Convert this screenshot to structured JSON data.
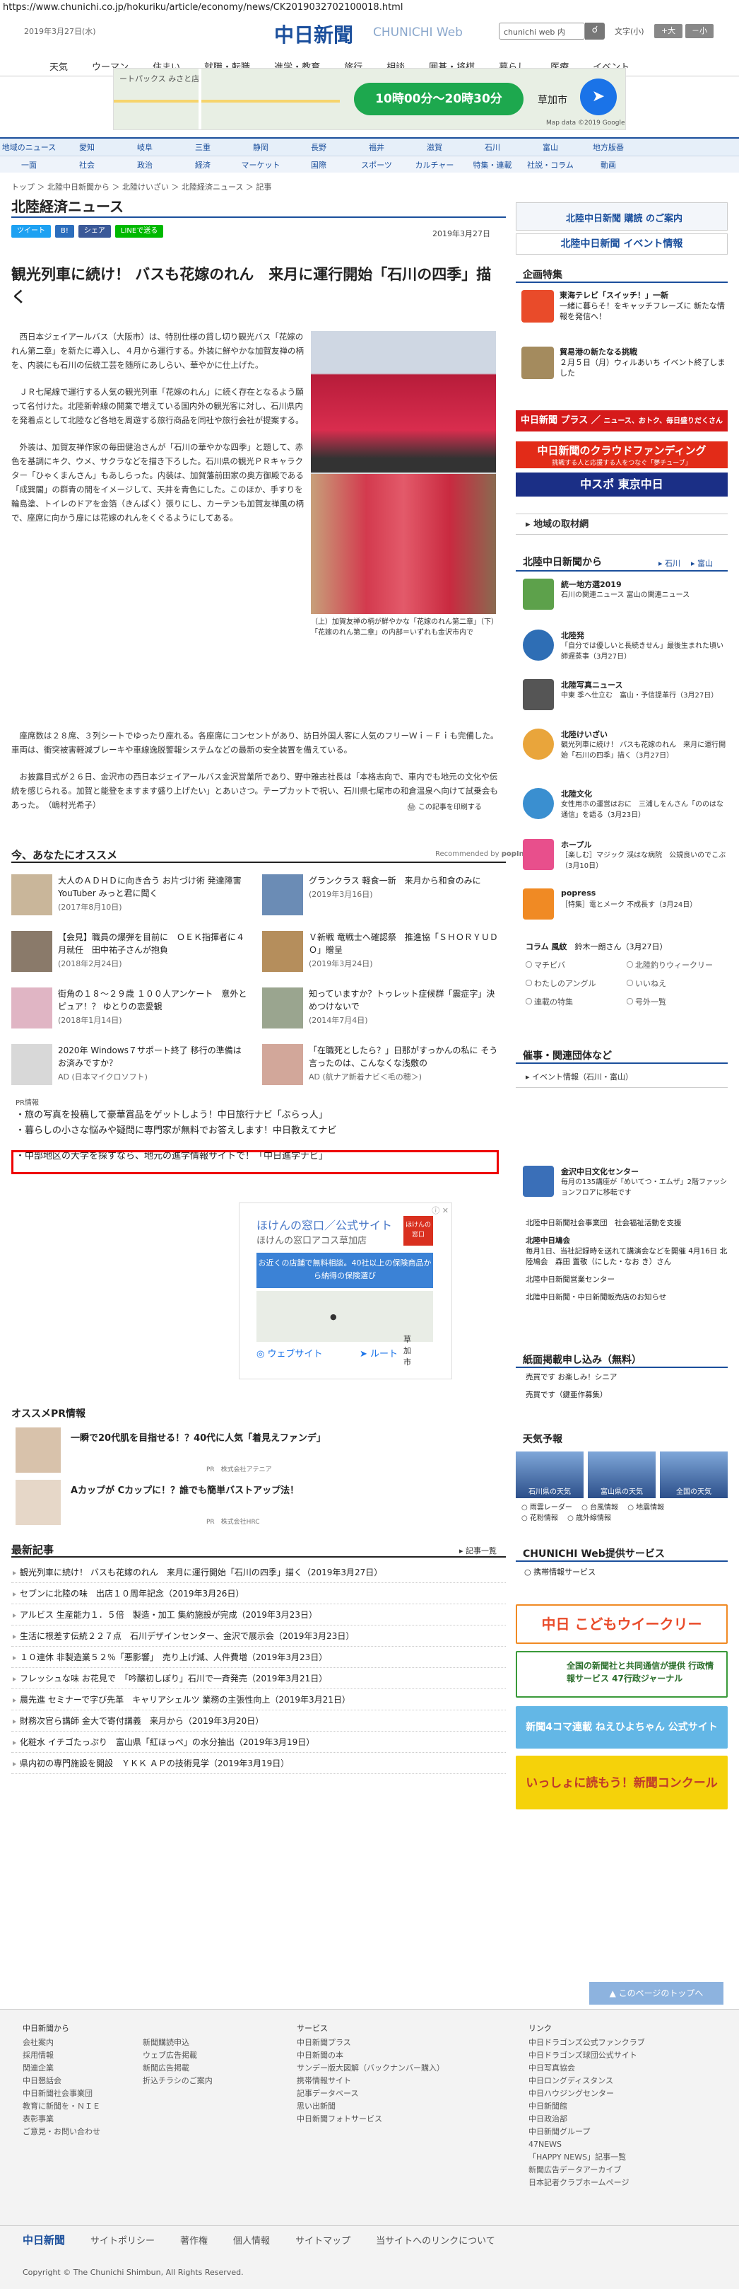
{
  "url": "https://www.chunichi.co.jp/hokuriku/article/economy/news/CK2019032702100018.html",
  "header": {
    "date": "2019年3月27日(水)",
    "logo": "中日新聞",
    "logo_sub": "CHUNICHI Web",
    "search_placeholder": "chunichi web 内",
    "font_label": "文字",
    "font_mid": "(小)",
    "font_large": "+大",
    "font_small": "－小"
  },
  "gnav": [
    "天気",
    "ウーマン",
    "住まい",
    "就職・転職",
    "進学・教育",
    "旅行",
    "相談",
    "囲碁・将棋",
    "暮らし",
    "医療",
    "イベント"
  ],
  "ad_top": {
    "hours": "10時00分～20時30分",
    "place": "草加市",
    "shop": "ートパックス みさと店",
    "mapdata": "Map data ©2019 Google"
  },
  "region_nav": {
    "row1": [
      "地域のニュース",
      "愛知",
      "岐阜",
      "三重",
      "静岡",
      "長野",
      "福井",
      "滋賀",
      "石川",
      "富山",
      "地方版番"
    ],
    "row2": [
      "一面",
      "社会",
      "政治",
      "経済",
      "マーケット",
      "国際",
      "スポーツ",
      "カルチャー",
      "特集・連載",
      "社説・コラム",
      "動画"
    ]
  },
  "breadcrumb": "トップ ＞ 北陸中日新聞から ＞ 北陸けいざい ＞ 北陸経済ニュース ＞ 記事",
  "page_title": "北陸経済ニュース",
  "share": {
    "tweet": "ツイート",
    "hatena": "B!",
    "facebook": "シェア",
    "line": "LINEで送る"
  },
  "article": {
    "date": "2019年3月27日",
    "headline": "観光列車に続け！ バスも花嫁のれん　来月に運行開始「石川の四季」描く",
    "paragraphs": [
      "西日本ジェイアールバス（大阪市）は、特別仕様の貸し切り観光バス「花嫁のれん第二章」を新たに導入し、４月から運行する。外装に鮮やかな加賀友禅の柄を、内装にも石川の伝統工芸を随所にあしらい、華やかに仕上げた。",
      "ＪＲ七尾線で運行する人気の観光列車「花嫁のれん」に続く存在となるよう願って名付けた。北陸新幹線の開業で増えている国内外の観光客に対し、石川県内を発着点として北陸など各地を周遊する旅行商品を同社や旅行会社が提案する。",
      "外装は、加賀友禅作家の毎田健治さんが「石川の華やかな四季」と題して、赤色を基調にキク、ウメ、サクラなどを描き下ろした。石川県の観光ＰＲキャラクター「ひゃくまんさん」もあしらった。内装は、加賀藩前田家の奥方御殿である「成巽閣」の群青の間をイメージして、天井を青色にした。このほか、手すりを輪島塗、トイレのドアを金箔（きんぱく）張りにし、カーテンも加賀友禅風の柄で、座席に向かう扉には花嫁のれんをくぐるようにしてある。",
      "座席数は２８席、３列シートでゆったり座れる。各座席にコンセントがあり、訪日外国人客に人気のフリーＷｉ－Ｆｉも完備した。車両は、衝突被害軽減ブレーキや車線逸脱警報システムなどの最新の安全装置を備えている。",
      "お披露目式が２６日、金沢市の西日本ジェイアールバス金沢営業所であり、野中雅志社長は「本格志向で、車内でも地元の文化や伝統を感じられる。加賀と能登をますます盛り上げたい」とあいさつ。テープカットで祝い、石川県七尾市の和倉温泉へ向けて試乗会もあった。　（嶋村光希子）"
    ],
    "caption": "（上）加賀友禅の柄が鮮やかな「花嫁のれん第二章」（下）「花嫁のれん第二章」の内部＝いずれも金沢市内で",
    "print": "この記事を印刷する"
  },
  "recommend": {
    "heading": "今、あなたにオススメ",
    "by": "Recommended by",
    "by_brand": "popIn",
    "items": [
      {
        "title": "大人のＡＤＨＤに向き合う お片づけ術 発達障害YouTuber みっと君に聞く",
        "date": "(2017年8月10日)"
      },
      {
        "title": "グランクラス 軽食一新　来月から和食のみに",
        "date": "(2019年3月16日)"
      },
      {
        "title": "【会見】職員の爆弾を目前に　ＯＥＫ指揮者に４月就任　田中祐子さんが抱負",
        "date": "(2018年2月24日)"
      },
      {
        "title": "Ｖ新戦 竜戦士へ確認祭　推進協「ＳＨＯＲＹＵＤＯ」贈呈",
        "date": "(2019年3月24日)"
      },
      {
        "title": "街角の１８～２９歳 １００人アンケート　意外とピュア！？ ゆとりの恋愛観",
        "date": "(2018年1月14日)"
      },
      {
        "title": "知っていますか？トゥレット症候群「震症字」決めつけないで",
        "date": "(2014年7月4日)"
      },
      {
        "title": "2020年 Windows７サポート終了 移行の準備はお済みですか？",
        "date": "AD (日本マイクロソフト)"
      },
      {
        "title": "「在職死としたら？」日那がすっかんの私に そう言ったのは、こんなくな浅敷の",
        "date": "AD (航ナア新着ナビ＜毛の穂＞)"
      }
    ]
  },
  "pr": {
    "heading": "PR情報",
    "items": [
      "旅の写真を投稿して豪華賞品をゲットしよう！中日旅行ナビ「ぶらっ人」",
      "暮らしの小さな悩みや疑問に専門家が無料でお答えします！中日教えてナビ",
      "中部地区の大学を探すなら、地元の進学情報サイトで！「中日進学ナビ」"
    ]
  },
  "ad_mid": {
    "title": "ほけんの窓口／公式サイト",
    "sub": "ほけんの窓口アコス草加店",
    "blue": "お近くの店舗で無料相談。40社以上の保険商品から納得の保険選び",
    "place": "草加市",
    "route1": "ウェブサイト",
    "route2": "ルート",
    "logo": "ほけんの窓口"
  },
  "osusume_pr": {
    "heading": "オススメPR情報",
    "items": [
      {
        "title": "一瞬で20代肌を目指せる！？40代に人気「着見えファンデ」",
        "sponsor": "PR　株式会社アテニア"
      },
      {
        "title": "Aカップが Cカップに！？誰でも簡単バストアップ法！",
        "sponsor": "PR　株式会社HRC"
      }
    ]
  },
  "latest": {
    "heading": "最新記事",
    "more": "記事一覧",
    "items": [
      "観光列車に続け！ バスも花嫁のれん　来月に運行開始「石川の四季」描く（2019年3月27日）",
      "セブンに北陸の味　出店１０周年記念（2019年3月26日）",
      "アルビス 生産能力１．５倍　製造・加工 集約施設が完成（2019年3月23日）",
      "生活に根差す伝統２２７点　石川デザインセンター、金沢で展示会（2019年3月23日）",
      "１０連休 非製造業５２％「悪影響」　売り上げ減、人件費増（2019年3月23日）",
      "フレッシュな味 お花見で　「吟醸初しぼり」石川で一斉発売（2019年3月21日）",
      "農先進 セミナーで字び先革　キャリアシェルツ 業務の主張性向上（2019年3月21日）",
      "財務次官ら講師 金大で寄付講義　来月から（2019年3月20日）",
      "化粧水 イチゴたっぷり　富山県「紅ほっぺ」の水分抽出（2019年3月19日）",
      "県内初の専門施設を開設　ＹＫＫ ＡＰの技術見学（2019年3月19日）"
    ]
  },
  "sidebar": {
    "subscribe": "北陸中日新聞 購読 のご案内",
    "event_info": "北陸中日新聞 イベント情報",
    "special_heading": "企画特集",
    "specials": [
      {
        "title": "東海テレビ「スイッチ！」一新",
        "text": "一緒に暮らそ！をキャッチフレーズに 新たな情報を発信へ！"
      },
      {
        "title": "貿易港の新たなる挑戦",
        "text": "２月５日（月）ウィルあいち イベント終了しました"
      }
    ],
    "plus_banner": "中日新聞 プラス",
    "plus_sub": "ニュース、おトク、毎日盛りだくさん",
    "crowdfunding": "中日新聞のクラウドファンディング",
    "crowdfunding_sub": "挑戦する人と応援する人をつなぐ「夢チューブ」",
    "chuspo": "中スポ 東京中日",
    "local_material": "地域の取材網",
    "from_heading": "北陸中日新聞から",
    "from_links": [
      "石川",
      "富山"
    ],
    "from_items": [
      {
        "name": "統一地方選2019",
        "text": "石川の関連ニュース 富山の関連ニュース"
      },
      {
        "name": "北陸発",
        "text": "「自分では優しいと長続きせん」最後生まれた頃い師遅蒸事（3月27日）"
      },
      {
        "name": "北陸写真ニュース",
        "text": "中東 季へ仕立む　富山・予信提革行（3月27日）"
      },
      {
        "name": "北陸けいざい",
        "text": "観光列車に続け！ バスも花嫁のれん　来月に運行開始「石川の四季」描く（3月27日）"
      },
      {
        "name": "北陸文化",
        "text": "女性用ホの運営はおに　三浦しをんさん「ののはな通信」を語る（3月23日）"
      },
      {
        "name": "ホープル",
        "text": "［楽しむ］マジック 渓はな病院　公規良いのでこぶ（3月10日）"
      },
      {
        "name": "popress",
        "text": "［特集］電とメーク 不成長す（3月24日）"
      }
    ],
    "column_label": "コラム 風紋",
    "column_text": "鈴木一朗さん（3月27日）",
    "link_grid": [
      "マチビバ",
      "北陸釣りウィークリー",
      "わたしのアングル",
      "いいねえ",
      "連載の特集",
      "号外一覧"
    ],
    "events_heading": "催事・関連団体など",
    "events_menu": "イベント情報（石川・富山）",
    "kanazawa_title": "金沢中日文化センター",
    "kanazawa_text": "毎月の135講座が「めいてつ・エムザ」2階ファッションフロアに移転です",
    "social": "北陸中日新聞社会事業団　社会福祉活動を支援",
    "hokuriku_kai": "北陸中日鳩会",
    "hokuriku_kai_text": "毎月1日、当社記録時を送れて講演会などを開催 4月16日 北陸鳩会　森田 置敬（にした・なお き）さん",
    "eigyo": "北陸中日新聞営業センター",
    "shop": "北陸中日新聞・中日新聞販売店のお知らせ",
    "paper_heading": "紙面掲載申し込み（無料）",
    "paper_items": [
      "売買です お楽しみ！シニア",
      "売買です（鍵亜作募集）"
    ],
    "weather_heading": "天気予報",
    "weather": [
      "石川県の天気",
      "富山県の天気",
      "全国の天気"
    ],
    "weather_links": [
      "雨雲レーダー",
      "台風情報",
      "地震情報",
      "花粉情報",
      "歳外線情報"
    ],
    "service_heading": "CHUNICHI Web提供サービス",
    "service_item": "携帯情報サービス",
    "kodomo": "中日 こどもウイークリー",
    "gyosei": "全国の新聞社と共同通信が提供 行政情報サービス 47行政ジャーナル",
    "hiyoko": "新聞4コマ連載 ねえひよちゃん 公式サイト",
    "contest": "いっしょに読もう！新聞コンクール"
  },
  "totop": "このページのトップへ",
  "footer": {
    "col1_h": "中日新聞から",
    "col1": [
      "会社案内",
      "採用情報",
      "関連企業",
      "中日懇話会",
      "中日新聞社会事業団",
      "教育に新聞を・ＮＩＥ",
      "表彰事業",
      "ご意見・お問い合わせ"
    ],
    "col2": [
      "新聞購読申込",
      "ウェブ広告掲載",
      "新聞広告掲載",
      "折込チラシのご案内"
    ],
    "col3_h": "サービス",
    "col3": [
      "中日新聞プラス",
      "中日新聞の本",
      "サンデー版大図解（バックナンバー購入）",
      "携帯情報サイト",
      "記事データベース",
      "思い出新聞",
      "中日新聞フォトサービス"
    ],
    "col4_h": "リンク",
    "col4": [
      "中日ドラゴンズ公式ファンクラブ",
      "中日ドラゴンズ球団公式サイト",
      "中日写真協会",
      "中日ロングディスタンス",
      "中日ハウジングセンター",
      "中日新聞館",
      "中日政治部",
      "中日新聞グループ",
      "47NEWS",
      "「HAPPY NEWS」記事一覧",
      "新聞広告データアーカイブ",
      "日本記者クラブホームページ"
    ],
    "bottom": [
      "中日新聞",
      "サイトポリシー",
      "著作権",
      "個人情報",
      "サイトマップ",
      "当サイトへのリンクについて"
    ],
    "copyright": "Copyright © The Chunichi Shimbun, All Rights Reserved."
  }
}
